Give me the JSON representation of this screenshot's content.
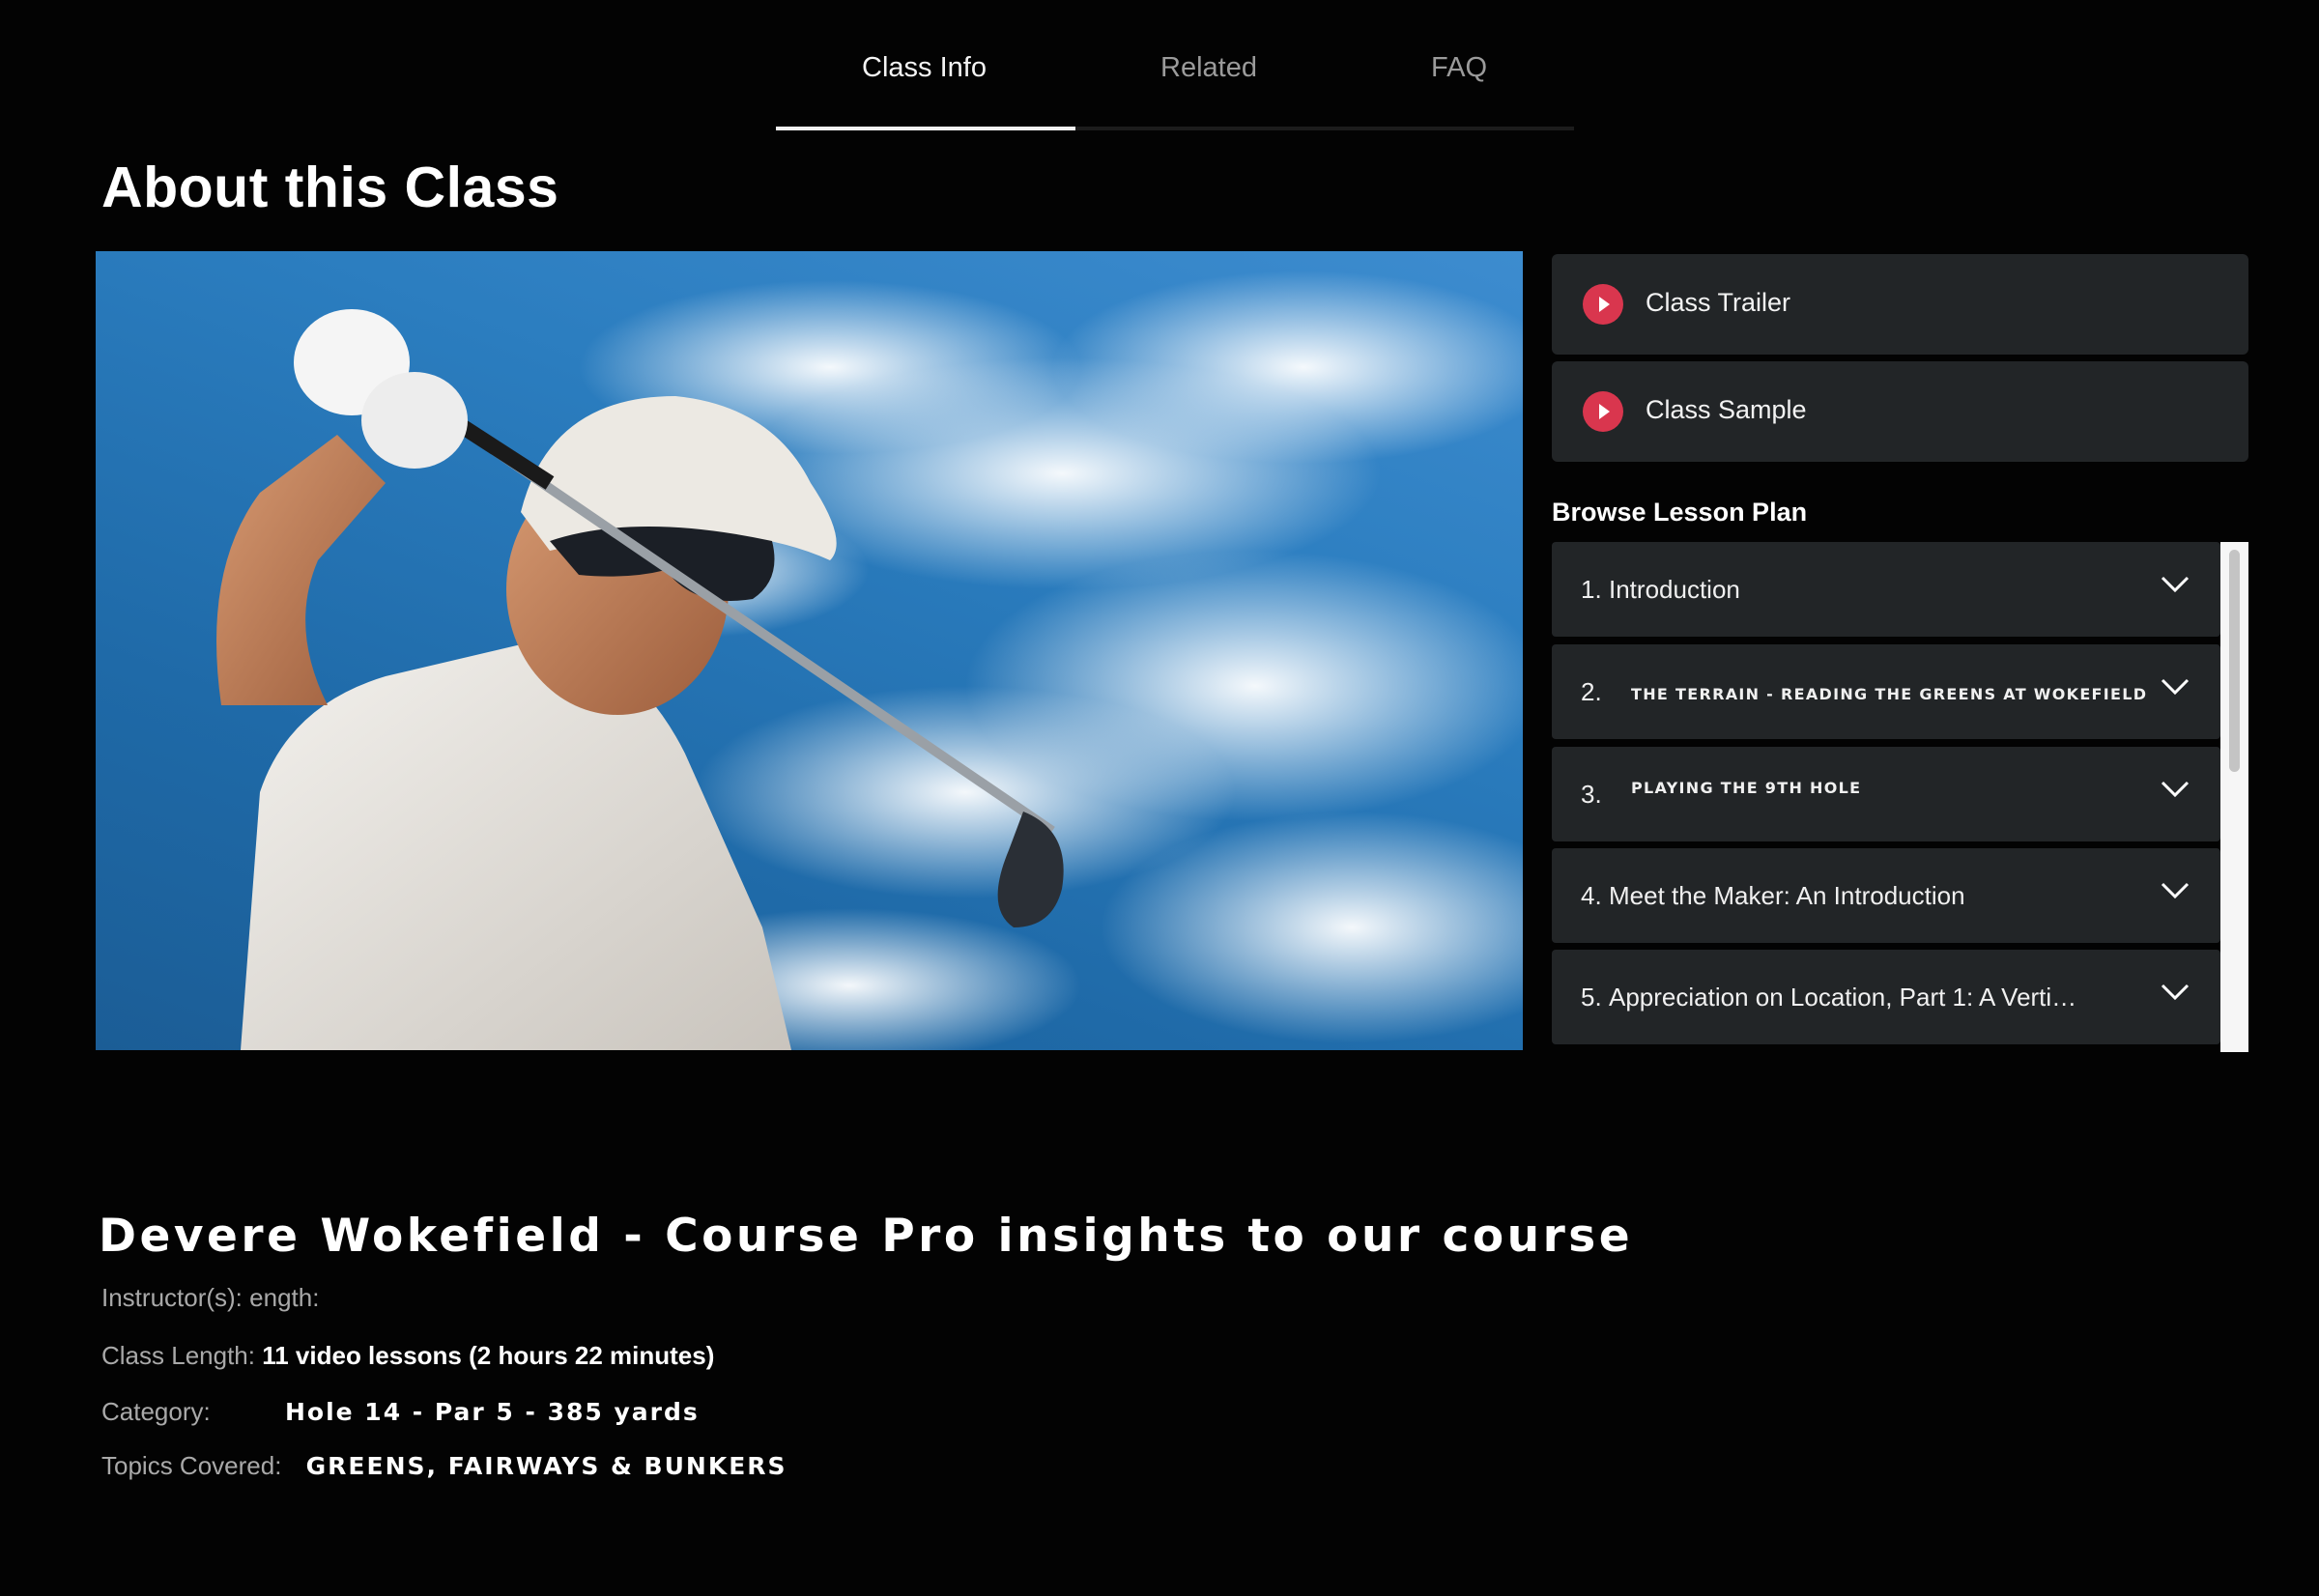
{
  "tabs": [
    {
      "label": "Class Info",
      "active": true
    },
    {
      "label": "Related",
      "active": false
    },
    {
      "label": "FAQ",
      "active": false
    }
  ],
  "page_title": "About this Class",
  "hero": {
    "icon": "golfer-swing-photo"
  },
  "sidebar": {
    "trailer_label": "Class Trailer",
    "sample_label": "Class Sample",
    "lesson_heading": "Browse Lesson Plan",
    "lessons": [
      {
        "num": "1.",
        "title": "Introduction"
      },
      {
        "num": "2.",
        "title": "THE TERRAIN - READING THE GREENS AT WOKEFIELD"
      },
      {
        "num": "3.",
        "title": "PLAYING THE 9TH HOLE"
      },
      {
        "num": "4.",
        "title": "Meet the Maker: An Introduction"
      },
      {
        "num": "5.",
        "title": "Appreciation on Location, Part 1: A Verti…"
      }
    ]
  },
  "course_title": "Devere Wokefield  - Course Pro insights to our course",
  "meta": {
    "instructor_label": "Instructor(s):",
    "instructor_value": "ength:",
    "length_label": "Class Length:",
    "length_value": "11 video lessons (2 hours 22 minutes)",
    "category_label": "Category:",
    "category_value": "Hole 14 - Par 5 - 385 yards",
    "topics_label": "Topics Covered:",
    "topics_value": "GREENS, FAIRWAYS & BUNKERS"
  },
  "colors": {
    "background": "#030303",
    "panel": "#222527",
    "accent_play": "#d9364e"
  }
}
